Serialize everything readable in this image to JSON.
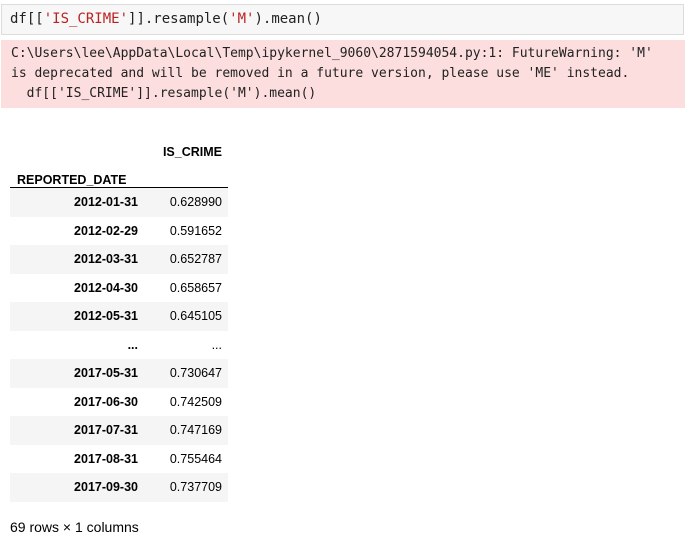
{
  "code": {
    "prefix": "df[[",
    "string1": "'IS_CRIME'",
    "middle": "]].resample(",
    "string2": "'M'",
    "suffix": ").mean()"
  },
  "warning": {
    "line1": "C:\\Users\\lee\\AppData\\Local\\Temp\\ipykernel_9060\\2871594054.py:1: FutureWarning: 'M'",
    "line2": "is deprecated and will be removed in a future version, please use 'ME' instead.",
    "line3": "  df[['IS_CRIME']].resample('M').mean()"
  },
  "table": {
    "column_header": "IS_CRIME",
    "index_name": "REPORTED_DATE",
    "rows": [
      {
        "index": "2012-01-31",
        "value": "0.628990"
      },
      {
        "index": "2012-02-29",
        "value": "0.591652"
      },
      {
        "index": "2012-03-31",
        "value": "0.652787"
      },
      {
        "index": "2012-04-30",
        "value": "0.658657"
      },
      {
        "index": "2012-05-31",
        "value": "0.645105"
      },
      {
        "index": "...",
        "value": "..."
      },
      {
        "index": "2017-05-31",
        "value": "0.730647"
      },
      {
        "index": "2017-06-30",
        "value": "0.742509"
      },
      {
        "index": "2017-07-31",
        "value": "0.747169"
      },
      {
        "index": "2017-08-31",
        "value": "0.755464"
      },
      {
        "index": "2017-09-30",
        "value": "0.737709"
      }
    ]
  },
  "footer": "69 rows × 1 columns"
}
